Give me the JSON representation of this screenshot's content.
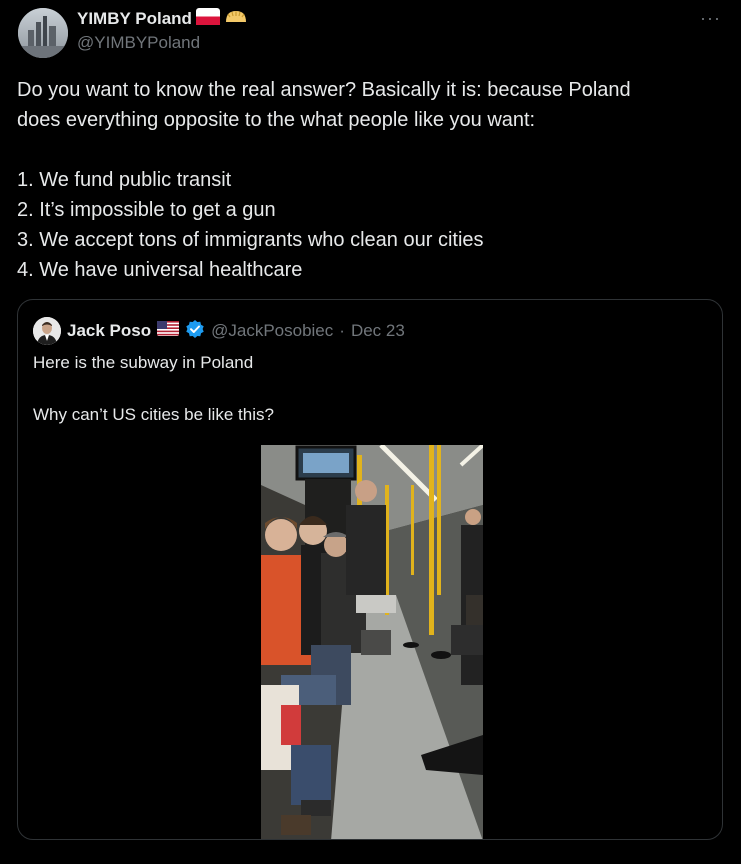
{
  "tweet": {
    "author_name": "YIMBY Poland",
    "author_handle": "@YIMBYPoland",
    "flag_icon": "poland-flag-icon",
    "extra_icon": "pierogi-icon",
    "more_icon": "more-icon",
    "more_label": "···",
    "text_lines": [
      "Do you want to know the real answer? Basically it is: because Poland",
      "does everything opposite to the what people like you want:",
      "",
      "1. We fund public transit",
      "2. It’s impossible to get a gun",
      "3. We accept tons of immigrants who clean our cities",
      "4. We have universal healthcare"
    ]
  },
  "quote": {
    "author_name": "Jack Poso",
    "flag_icon": "us-flag-icon",
    "verified_icon": "verified-badge-icon",
    "author_handle": "@JackPosobiec",
    "separator": "·",
    "date": "Dec 23",
    "text_lines": [
      "Here is the subway in Poland",
      "",
      "Why can’t US cities be like this?"
    ],
    "media_icon": "subway-video-thumbnail"
  },
  "colors": {
    "background": "#000000",
    "text_primary": "#e7e9ea",
    "text_secondary": "#71767b",
    "border": "#2f3336",
    "verified": "#1d9bf0"
  }
}
